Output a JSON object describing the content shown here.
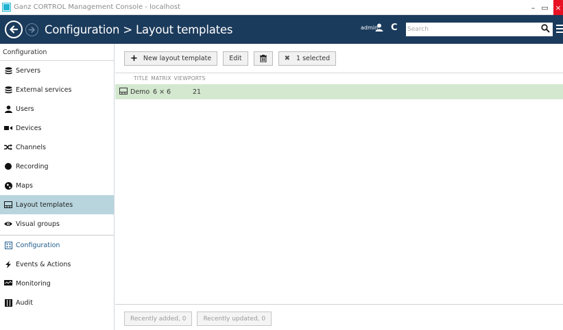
{
  "window": {
    "title": "Ganz CORTROL Management Console - localhost",
    "min_glyph": "–",
    "max_glyph": "▭",
    "close_glyph": "×"
  },
  "header": {
    "breadcrumb": "Configuration > Layout templates",
    "user": "admin",
    "refresh_glyph": "C",
    "search_placeholder": "Search"
  },
  "sidebar": {
    "heading": "Configuration",
    "items": [
      {
        "label": "Servers",
        "icon": "database-icon"
      },
      {
        "label": "External services",
        "icon": "database-icon"
      },
      {
        "label": "Users",
        "icon": "user-icon"
      },
      {
        "label": "Devices",
        "icon": "camera-icon"
      },
      {
        "label": "Channels",
        "icon": "shuffle-icon"
      },
      {
        "label": "Recording",
        "icon": "record-icon"
      },
      {
        "label": "Maps",
        "icon": "globe-icon"
      },
      {
        "label": "Layout templates",
        "icon": "layout-icon",
        "active": true
      },
      {
        "label": "Visual groups",
        "icon": "eye-icon"
      }
    ],
    "sections": [
      {
        "label": "Configuration",
        "icon": "grid-icon",
        "active": true
      },
      {
        "label": "Events & Actions",
        "icon": "bolt-icon"
      },
      {
        "label": "Monitoring",
        "icon": "monitor-icon"
      },
      {
        "label": "Audit",
        "icon": "book-icon"
      }
    ]
  },
  "toolbar": {
    "new_label": "New layout template",
    "edit_label": "Edit",
    "selected_label": "1 selected"
  },
  "table": {
    "columns": [
      "TITLE",
      "MATRIX",
      "VIEWPORTS"
    ],
    "rows": [
      {
        "title": "Demo",
        "matrix": "6 × 6",
        "viewports": "21"
      }
    ]
  },
  "footer": {
    "recently_added": "Recently added, 0",
    "recently_updated": "Recently updated, 0"
  },
  "colors": {
    "header_bg": "#1b3b5c",
    "selected_row": "#d3e8cf",
    "active_sidebar": "#b8d5de",
    "close_button": "#e81123"
  }
}
